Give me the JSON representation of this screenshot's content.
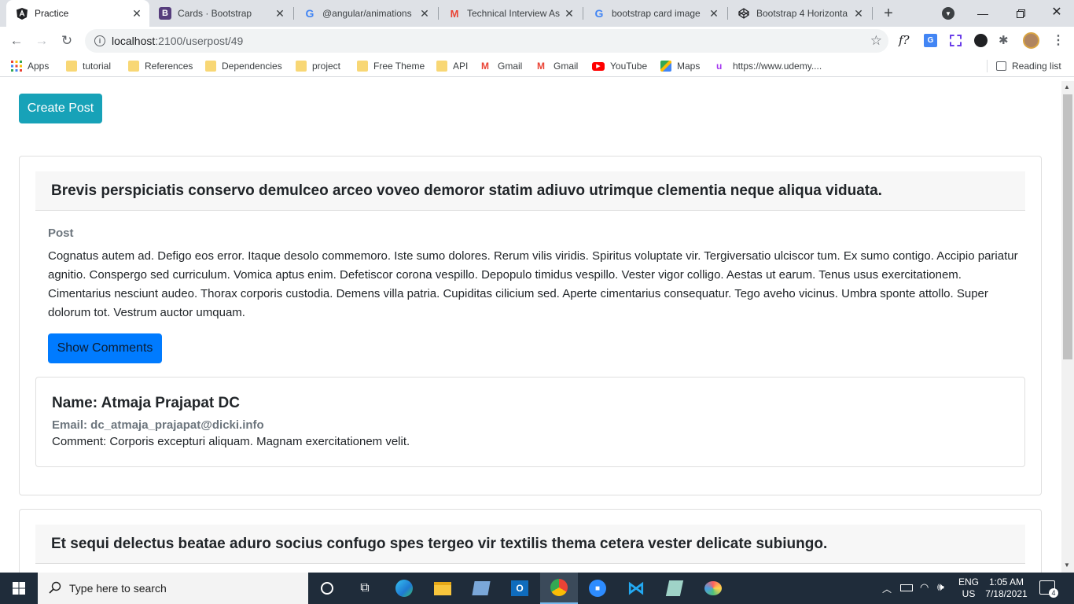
{
  "browser": {
    "tabs": [
      {
        "title": "Practice",
        "icon": "angular-icon"
      },
      {
        "title": "Cards · Bootstrap",
        "icon": "bootstrap-icon"
      },
      {
        "title": "@angular/animations",
        "icon": "google-icon"
      },
      {
        "title": "Technical Interview As",
        "icon": "gmail-icon"
      },
      {
        "title": "bootstrap card image",
        "icon": "google-icon"
      },
      {
        "title": "Bootstrap 4 Horizonta",
        "icon": "codepen-icon"
      }
    ],
    "url_host": "localhost",
    "url_path": ":2100/userpost/49",
    "bookmarks": [
      {
        "label": "Apps"
      },
      {
        "label": "tutorial"
      },
      {
        "label": "References"
      },
      {
        "label": "Dependencies"
      },
      {
        "label": "project"
      },
      {
        "label": "Free Theme"
      },
      {
        "label": "API"
      },
      {
        "label": "Gmail"
      },
      {
        "label": "Gmail"
      },
      {
        "label": "YouTube"
      },
      {
        "label": "Maps"
      },
      {
        "label": "https://www.udemy...."
      }
    ],
    "reading_list": "Reading list",
    "ext_f": "f?"
  },
  "page": {
    "create_button": "Create Post",
    "posts": [
      {
        "title": "Brevis perspiciatis conservo demulceo arceo voveo demoror statim adiuvo utrimque clementia neque aliqua viduata.",
        "subtitle": "Post",
        "body": "Cognatus autem ad. Defigo eos error. Itaque desolo commemoro. Iste sumo dolores. Rerum vilis viridis. Spiritus voluptate vir. Tergiversatio ulciscor tum. Ex sumo contigo. Accipio pariatur agnitio. Conspergo sed curriculum. Vomica aptus enim. Defetiscor corona vespillo. Depopulo timidus vespillo. Vester vigor colligo. Aestas ut earum. Tenus usus exercitationem. Cimentarius nesciunt audeo. Thorax corporis custodia. Demens villa patria. Cupiditas cilicium sed. Aperte cimentarius consequatur. Tego aveho vicinus. Umbra sponte attollo. Super dolorum tot. Vestrum auctor umquam.",
        "show_comments": "Show Comments",
        "comment": {
          "name": "Name: Atmaja Prajapat DC",
          "email": "Email: dc_atmaja_prajapat@dicki.info",
          "text": "Comment: Corporis excepturi aliquam. Magnam exercitationem velit."
        }
      },
      {
        "title": "Et sequi delectus beatae aduro socius confugo spes tergeo vir textilis thema cetera vester delicate subiungo."
      }
    ]
  },
  "taskbar": {
    "search_placeholder": "Type here to search",
    "lang": "ENG",
    "region": "US",
    "time": "1:05 AM",
    "date": "7/18/2021",
    "notifications": "4"
  },
  "colors": {
    "info": "#17a2b8",
    "primary": "#007bff",
    "muted": "#6c757d"
  }
}
